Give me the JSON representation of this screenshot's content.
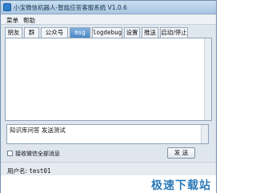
{
  "window": {
    "title": "小宝微信机器人-智能应答客服系统 V1.0.6"
  },
  "menu": {
    "items": [
      "菜单",
      "帮助"
    ]
  },
  "tabs": [
    "朋友",
    "群",
    "公众号",
    "msg",
    "logdebug",
    "设置",
    "推送",
    "启动/停止"
  ],
  "active_tab_index": 3,
  "compose": {
    "text": "知识库问答 发送测试"
  },
  "options": {
    "receive_all_label": "接收微信全部消息",
    "receive_all_checked": false
  },
  "buttons": {
    "send": "发 送"
  },
  "status": {
    "user_label": "用户名:",
    "user_value": "test01"
  },
  "watermark": {
    "text": "极速下载站"
  },
  "colors": {
    "active_tab": "#4d88c6",
    "window_border": "#6f8fae",
    "watermark": "#2c7ab8"
  }
}
